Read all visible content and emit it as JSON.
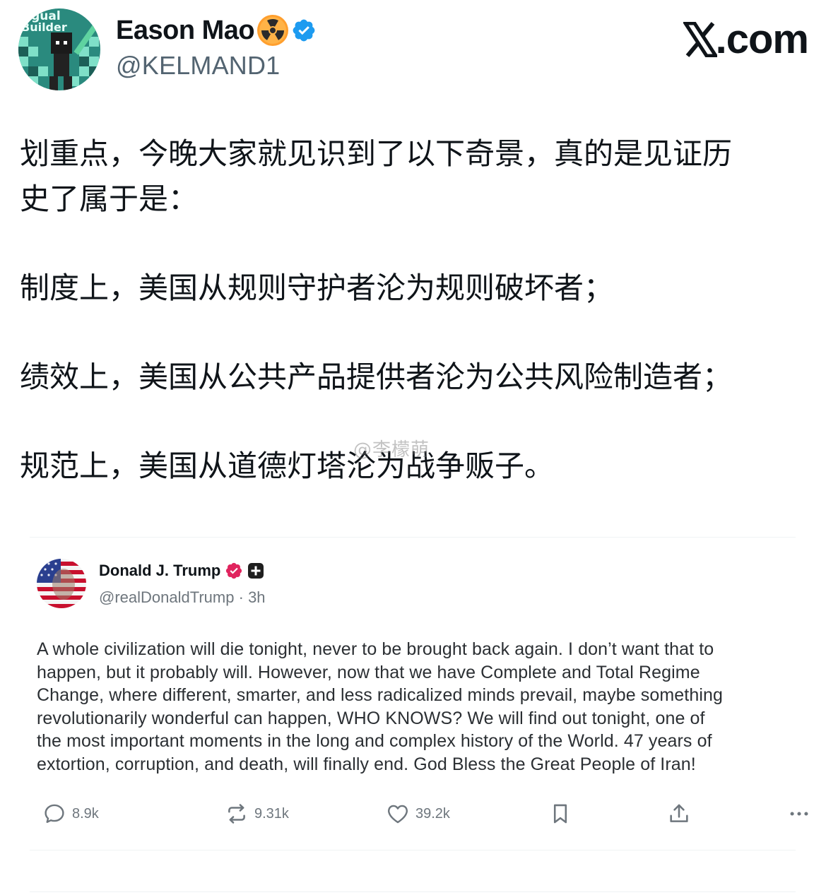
{
  "post": {
    "author": {
      "display_name": "Eason Mao",
      "handle": "@KELMAND1",
      "avatar_text_line1": "ngual",
      "avatar_text_line2": "Builder",
      "name_badge_icon": "radioactive-icon",
      "verified_icon": "verified-badge-icon",
      "verified_color": "#1d9bf0",
      "radio_color": "#ff9f2e"
    },
    "site": {
      "text": ".com",
      "logo_icon": "x-logo-icon"
    },
    "body": {
      "paragraph_1_line_1": "划重点，今晚大家就见识到了以下奇景，真的是见证历",
      "paragraph_1_line_2": "史了属于是：",
      "paragraph_2": "制度上，美国从规则守护者沦为规则破坏者；",
      "paragraph_3": "绩效上，美国从公共产品提供者沦为公共风险制造者；",
      "paragraph_4": "规范上，美国从道德灯塔沦为战争贩子。"
    },
    "watermark": "@李檬萌"
  },
  "quoted": {
    "author": {
      "display_name": "Donald J. Trump",
      "handle": "@realDonaldTrump",
      "separator": "·",
      "time": "3h",
      "badge_icon": "verified-badge-icon",
      "badge_color": "#e0245e",
      "plus_icon": "plus-square-icon"
    },
    "text_lines": [
      "A whole civilization will die tonight, never to be brought back again. I don’t want that to",
      "happen, but it probably will. However, now that we have Complete and Total Regime",
      "Change, where different, smarter, and less radicalized minds prevail, maybe something",
      "revolutionarily wonderful can happen, WHO KNOWS? We will find out tonight, one of",
      "the most important moments in the long and complex history of the World. 47 years of",
      "extortion, corruption, and death, will finally end. God Bless the Great People of Iran!"
    ],
    "actions": {
      "replies": "8.9k",
      "reposts": "9.31k",
      "likes": "39.2k",
      "reply_icon": "comment-icon",
      "repost_icon": "repost-icon",
      "like_icon": "heart-icon",
      "bookmark_icon": "bookmark-icon",
      "share_icon": "share-icon",
      "more_icon": "more-icon"
    }
  }
}
